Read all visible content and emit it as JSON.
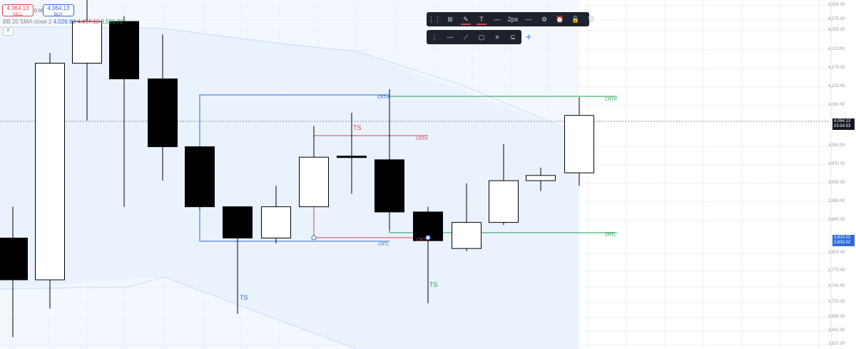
{
  "trade": {
    "sell_price": "4,064.13",
    "sell_label": "SELL",
    "spread": "0.00",
    "buy_price": "4,064.13",
    "buy_label": "BUY"
  },
  "indicator": {
    "name": "BB 20 SMA close 2",
    "value1": "4,026.93",
    "value2": "4,457.13",
    "value3": "3,596.72",
    "collapse_icon": "chevron-up-icon"
  },
  "toolbar_top": {
    "items": [
      {
        "name": "grip-icon",
        "label": "⋮⋮"
      },
      {
        "name": "template-icon",
        "label": "⊞"
      },
      {
        "name": "pencil-icon",
        "label": "✎"
      },
      {
        "name": "text-icon",
        "label": "T"
      },
      {
        "name": "line-style-icon",
        "label": "—"
      },
      {
        "name": "line-width",
        "label": "2px"
      },
      {
        "name": "line-solid-icon",
        "label": "—"
      },
      {
        "name": "settings-icon",
        "label": "⚙"
      },
      {
        "name": "alert-icon",
        "label": "⏰"
      },
      {
        "name": "lock-icon",
        "label": "🔓"
      },
      {
        "name": "trash-icon",
        "label": "🗑"
      },
      {
        "name": "more-icon",
        "label": "···"
      }
    ]
  },
  "toolbar_bottom": {
    "items": [
      {
        "name": "grip-icon",
        "label": "⋮"
      },
      {
        "name": "horizontal-ray-icon",
        "label": "-◦-"
      },
      {
        "name": "trend-line-icon",
        "label": "⟋"
      },
      {
        "name": "rectangle-icon",
        "label": "▢"
      },
      {
        "name": "parallel-channel-icon",
        "label": "≡"
      },
      {
        "name": "fib-icon",
        "label": "⊆"
      },
      {
        "name": "crosshair-icon",
        "label": "✛"
      }
    ]
  },
  "price_axis": {
    "labels": [
      "4,300.00",
      "4,275.00",
      "4,250.00",
      "4,210.00",
      "4,170.00",
      "4,130.00",
      "4,090.00",
      "4,050.00",
      "3,970.00",
      "3,930.00",
      "3,890.00",
      "3,860.00",
      "3,800.00",
      "3,770.00",
      "3,740.00",
      "3,710.00",
      "3,685.00",
      "3,661.00",
      "3,637.00"
    ],
    "last_price": "4,064.13",
    "countdown": "03:54:53",
    "line_price_1": "3,833.02",
    "line_price_2": "3,833.02"
  },
  "drawings": {
    "crth_labels": [
      "CRTH",
      "CRTH",
      "CRTH"
    ],
    "crtl_labels": [
      "CRTL",
      "CRTL",
      "CRTL"
    ],
    "ts_labels": [
      "TS",
      "TS",
      "TS"
    ]
  },
  "colors": {
    "up_candle": "#ffffff",
    "down_candle": "#000000",
    "blue_line": "#2f6ad9",
    "red_line": "#e0414a",
    "green_line": "#1e9b4d",
    "bb_band": "#c9dcf5",
    "bb_fill": "#eaf3fd"
  },
  "chart_data": {
    "type": "candlestick",
    "title": "",
    "ylim": [
      3630,
      4305
    ],
    "candles": [
      {
        "o": 3835,
        "h": 3895,
        "l": 3645,
        "c": 3755
      },
      {
        "o": 3755,
        "h": 4190,
        "l": 3700,
        "c": 4170
      },
      {
        "o": 4170,
        "h": 4295,
        "l": 4060,
        "c": 4250
      },
      {
        "o": 4250,
        "h": 4260,
        "l": 3895,
        "c": 4140
      },
      {
        "o": 4140,
        "h": 4225,
        "l": 3945,
        "c": 4010
      },
      {
        "o": 4010,
        "h": 4010,
        "l": 3890,
        "c": 3895
      },
      {
        "o": 3895,
        "h": 3895,
        "l": 3690,
        "c": 3835
      },
      {
        "o": 3835,
        "h": 3935,
        "l": 3825,
        "c": 3895
      },
      {
        "o": 3895,
        "h": 4050,
        "l": 3895,
        "c": 3990
      },
      {
        "o": 3992,
        "h": 4075,
        "l": 3920,
        "c": 3990
      },
      {
        "o": 3985,
        "h": 4120,
        "l": 3850,
        "c": 3885
      },
      {
        "o": 3885,
        "h": 3895,
        "l": 3710,
        "c": 3830
      },
      {
        "o": 3815,
        "h": 3940,
        "l": 3810,
        "c": 3865
      },
      {
        "o": 3865,
        "h": 4015,
        "l": 3860,
        "c": 3945
      },
      {
        "o": 3945,
        "h": 3970,
        "l": 3925,
        "c": 3955
      },
      {
        "o": 3960,
        "h": 4105,
        "l": 3935,
        "c": 4070
      }
    ]
  }
}
